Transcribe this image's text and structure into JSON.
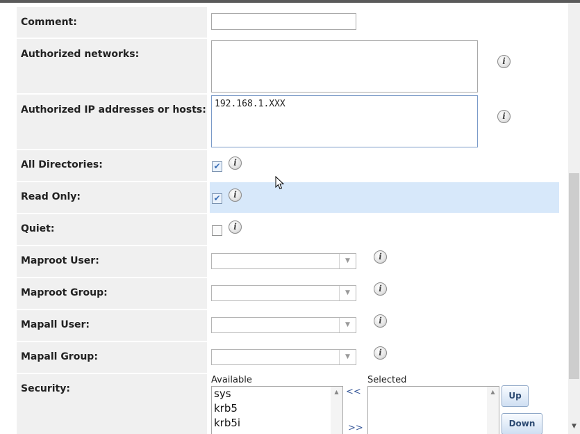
{
  "form": {
    "comment": {
      "label": "Comment:",
      "value": ""
    },
    "authorized_networks": {
      "label": "Authorized networks:",
      "value": ""
    },
    "authorized_hosts": {
      "label": "Authorized IP addresses or hosts:",
      "value": "192.168.1.XXX"
    },
    "all_directories": {
      "label": "All Directories:",
      "checked": true
    },
    "read_only": {
      "label": "Read Only:",
      "checked": true
    },
    "quiet": {
      "label": "Quiet:",
      "checked": false
    },
    "maproot_user": {
      "label": "Maproot User:",
      "value": ""
    },
    "maproot_group": {
      "label": "Maproot Group:",
      "value": ""
    },
    "mapall_user": {
      "label": "Mapall User:",
      "value": ""
    },
    "mapall_group": {
      "label": "Mapall Group:",
      "value": ""
    },
    "security": {
      "label": "Security:",
      "available_caption": "Available",
      "selected_caption": "Selected",
      "available": [
        "sys",
        "krb5",
        "krb5i"
      ],
      "selected": [],
      "remove_label": "<<",
      "add_label": ">>",
      "up_label": "Up",
      "down_label": "Down"
    }
  },
  "info_glyph": "i",
  "check_glyph": "✔",
  "colors": {
    "highlight_row": "#d7e8fa",
    "label_bg": "#f0f0f0"
  }
}
